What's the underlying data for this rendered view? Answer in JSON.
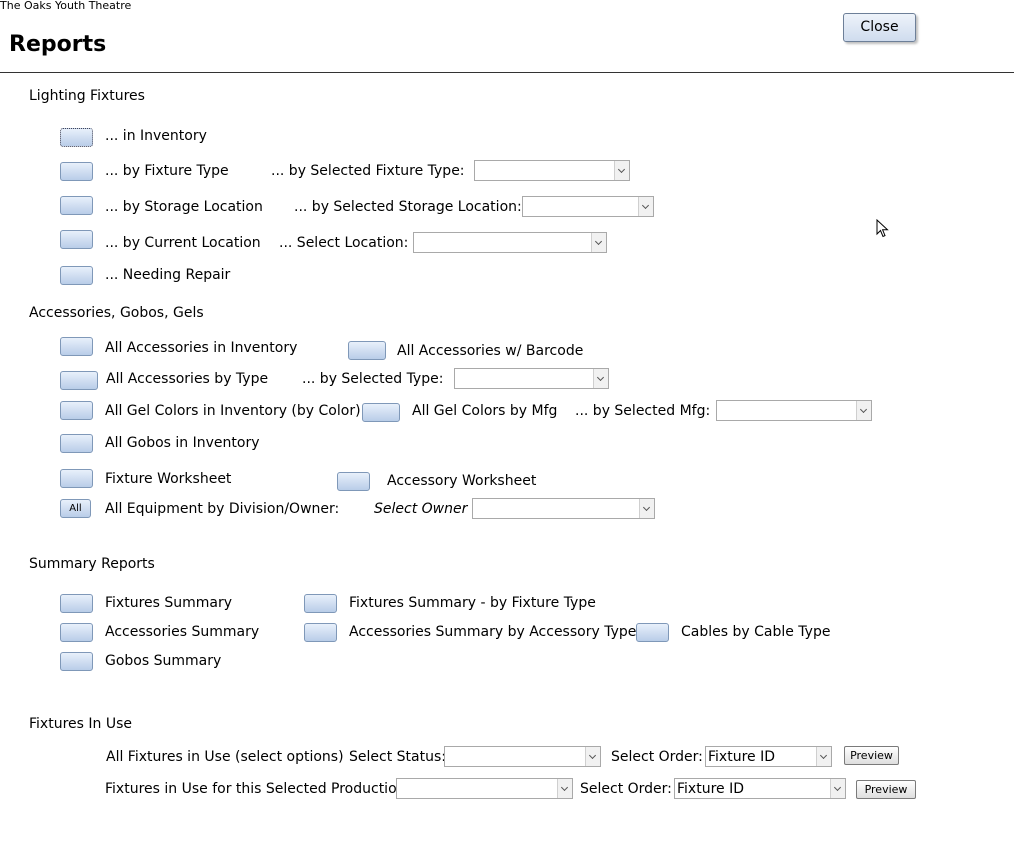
{
  "app": {
    "title": "The Oaks Youth Theatre"
  },
  "page": {
    "title": "Reports",
    "close_label": "Close"
  },
  "lighting": {
    "heading": "Lighting Fixtures",
    "in_inventory": "... in Inventory",
    "by_fixture_type": "... by Fixture Type",
    "by_selected_fixture_type": "... by Selected Fixture Type:",
    "by_storage_location": "... by Storage Location",
    "by_selected_storage_location": "... by Selected Storage Location:",
    "by_current_location": "... by Current Location",
    "select_location": "... Select Location:",
    "needing_repair": "... Needing Repair"
  },
  "accessories": {
    "heading": "Accessories, Gobos, Gels",
    "all_in_inventory": "All Accessories in Inventory",
    "all_with_barcode": "All Accessories w/ Barcode",
    "all_by_type": "All Accessories by Type",
    "by_selected_type": "... by Selected Type:",
    "gel_colors_inventory": "All Gel Colors in Inventory (by Color)",
    "gel_colors_by_mfg": "All Gel Colors by Mfg",
    "by_selected_mfg": "... by Selected Mfg:",
    "all_gobos": "All Gobos in Inventory",
    "fixture_worksheet": "Fixture Worksheet",
    "accessory_worksheet": "Accessory Worksheet",
    "all_button_label": "All",
    "all_equipment_by_owner": "All Equipment by Division/Owner:",
    "select_owner": "Select Owner :"
  },
  "summary": {
    "heading": "Summary Reports",
    "fixtures_summary": "Fixtures Summary",
    "fixtures_summary_by_type": "Fixtures Summary - by Fixture Type",
    "accessories_summary": "Accessories  Summary",
    "accessories_summary_by_type": "Accessories  Summary by Accessory Type",
    "cables_by_type": "Cables by Cable Type",
    "gobos_summary": "Gobos Summary"
  },
  "in_use": {
    "heading": "Fixtures In Use",
    "all_in_use": "All Fixtures in Use (select options)",
    "select_status": "Select Status:",
    "select_order_1": "Select Order:",
    "order_value_1": "Fixture ID",
    "preview_1": "Preview",
    "for_production": "Fixtures in Use for this Selected Production:",
    "select_order_2": "Select Order:",
    "order_value_2": "Fixture ID",
    "preview_2": "Preview"
  }
}
